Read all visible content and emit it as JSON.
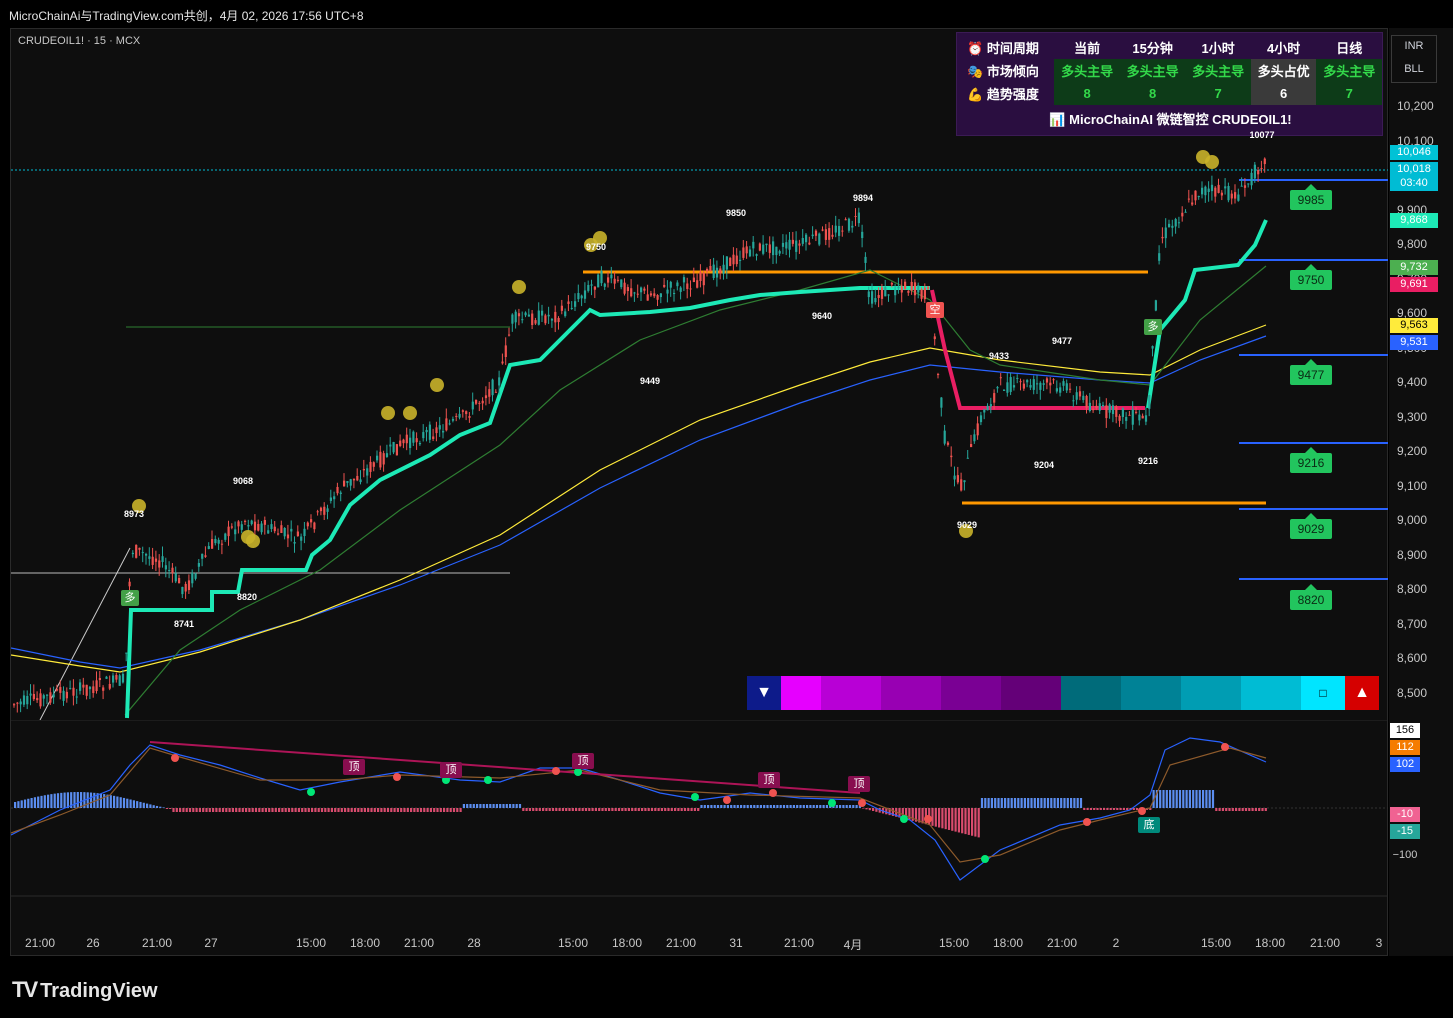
{
  "topbar": {
    "text": "MicroChainAi与TradingView.com共创，4月 02, 2026 17:56 UTC+8"
  },
  "symbol": "CRUDEOIL1! · 15 · MCX",
  "panel": {
    "headers": [
      "时间周期",
      "当前",
      "15分钟",
      "1小时",
      "4小时",
      "日线"
    ],
    "row1": {
      "label": "市场倾向",
      "values": [
        "多头主导",
        "多头主导",
        "多头主导",
        "多头占优",
        "多头主导"
      ]
    },
    "row2": {
      "label": "趋势强度",
      "values": [
        "8",
        "8",
        "7",
        "6",
        "7"
      ]
    },
    "footer": "MicroChainAI 微链智控 CRUDEOIL1!"
  },
  "currency": {
    "line1": "INR",
    "line2": "BLL"
  },
  "price_ticks": [
    "10,200",
    "10,100",
    "10,000",
    "9,900",
    "9,800",
    "9,700",
    "9,600",
    "9,500",
    "9,400",
    "9,300",
    "9,200",
    "9,100",
    "9,000",
    "8,900",
    "8,800",
    "8,700",
    "8,600",
    "8,500"
  ],
  "price_labels": [
    {
      "text": "10,046",
      "color": "#00c2d6"
    },
    {
      "text": "10,018",
      "color": "#00bcd4"
    },
    {
      "text": "03:40",
      "color": "#00bcd4"
    },
    {
      "text": "9,868",
      "color": "#1de9b6"
    },
    {
      "text": "9,732",
      "color": "#4caf50"
    },
    {
      "text": "9,691",
      "color": "#e91e63"
    },
    {
      "text": "9,563",
      "color": "#ffeb3b"
    },
    {
      "text": "9,531",
      "color": "#2962ff"
    }
  ],
  "macd_labels": [
    {
      "text": "156",
      "color": "#ffffff"
    },
    {
      "text": "112",
      "color": "#f57c00"
    },
    {
      "text": "102",
      "color": "#2962ff"
    },
    {
      "text": "-10",
      "color": "#f06292"
    },
    {
      "text": "-15",
      "color": "#26a69a"
    },
    {
      "text": "−100",
      "color": "#000000"
    }
  ],
  "levels": [
    "9985",
    "9750",
    "9477",
    "9216",
    "9029",
    "8820"
  ],
  "peaks": [
    "10077",
    "9894",
    "9850",
    "9750",
    "9640",
    "9449",
    "9477",
    "9433",
    "9204",
    "9216",
    "9029",
    "9068",
    "8973",
    "8820",
    "8741"
  ],
  "tags": {
    "long": "多",
    "short": "空",
    "top": "顶",
    "bottom": "底",
    "edge": "底"
  },
  "x_ticks": [
    "21:00",
    "26",
    "21:00",
    "27",
    "15:00",
    "18:00",
    "21:00",
    "28",
    "15:00",
    "18:00",
    "21:00",
    "31",
    "21:00",
    "4月",
    "15:00",
    "18:00",
    "21:00",
    "2",
    "15:00",
    "18:00",
    "21:00",
    "3"
  ],
  "brand": "TradingView",
  "colors": {
    "green": "#22c55e",
    "pink": "#e91e63",
    "orange": "#ff9800",
    "blue": "#2962ff",
    "yellow": "#ffeb3b"
  }
}
